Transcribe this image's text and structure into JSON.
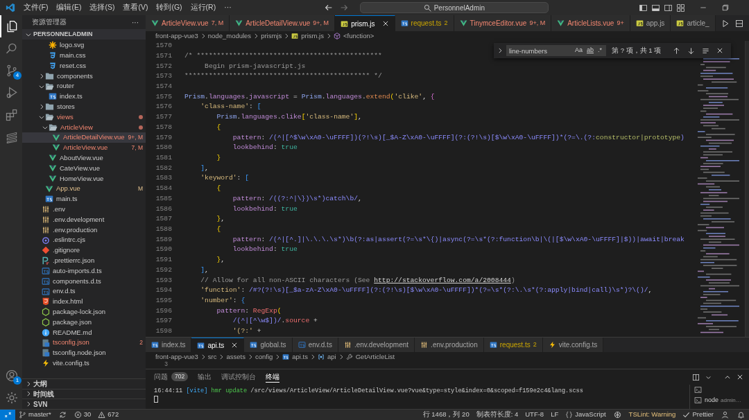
{
  "title_bar": {
    "menus": [
      "文件(F)",
      "编辑(E)",
      "选择(S)",
      "查看(V)",
      "转到(G)",
      "运行(R)",
      "···"
    ],
    "command_center": "PersonnelAdmin"
  },
  "activity_bar": {
    "items": [
      {
        "kind": "explorer",
        "selected": true
      },
      {
        "kind": "search",
        "selected": false
      },
      {
        "kind": "source-control",
        "selected": false,
        "badge": "4"
      },
      {
        "kind": "run-debug",
        "selected": false
      },
      {
        "kind": "extensions",
        "selected": false
      },
      {
        "kind": "s-plugin",
        "selected": false
      }
    ],
    "bottom": [
      {
        "kind": "account",
        "badge": "1"
      },
      {
        "kind": "settings"
      }
    ]
  },
  "sidebar": {
    "title": "资源管理器",
    "more": "···",
    "section": "PERSONNELADMIN",
    "tree": [
      {
        "children": [
          {
            "children": [
              {
                "label": "logo.svg",
                "kind": "svg",
                "selected": false
              },
              {
                "label": "main.css",
                "kind": "css",
                "selected": false
              },
              {
                "label": "reset.css",
                "kind": "css",
                "selected": false
              }
            ]
          },
          {
            "label": "components",
            "kind": "folder",
            "expanded": false,
            "selected": false
          },
          {
            "label": "router",
            "kind": "folder",
            "expanded": true,
            "selected": false,
            "children": [
              {
                "label": "index.ts",
                "kind": "ts",
                "selected": false
              }
            ]
          },
          {
            "label": "stores",
            "kind": "folder",
            "expanded": false,
            "selected": false
          },
          {
            "label": "views",
            "kind": "folder",
            "expanded": true,
            "selected": false,
            "error": true,
            "dot": true,
            "children": [
              {
                "label": "ArticleView",
                "kind": "folder",
                "expanded": true,
                "selected": false,
                "error": true,
                "dot": true,
                "children": [
                  {
                    "label": "ArticleDetailView.vue",
                    "kind": "vue",
                    "selected": true,
                    "error": true,
                    "badge": "9+, M"
                  },
                  {
                    "label": "ArticleView.vue",
                    "kind": "vue",
                    "selected": false,
                    "error": true,
                    "badge": "7, M"
                  }
                ]
              },
              {
                "label": "AboutView.vue",
                "kind": "vue",
                "selected": false
              },
              {
                "label": "CateView.vue",
                "kind": "vue",
                "selected": false
              },
              {
                "label": "HomeView.vue",
                "kind": "vue",
                "selected": false
              }
            ]
          },
          {
            "label": "App.vue",
            "kind": "vue",
            "selected": false,
            "modified": true,
            "badge": "M"
          },
          {
            "label": "main.ts",
            "kind": "ts",
            "selected": false
          }
        ]
      },
      {
        "label": ".env",
        "kind": "env",
        "selected": false
      },
      {
        "label": ".env.development",
        "kind": "env",
        "selected": false
      },
      {
        "label": ".env.production",
        "kind": "env",
        "selected": false
      },
      {
        "label": ".eslintrc.cjs",
        "kind": "eslint",
        "selected": false
      },
      {
        "label": ".gitignore",
        "kind": "git",
        "selected": false
      },
      {
        "label": ".prettierrc.json",
        "kind": "prettier",
        "selected": false
      },
      {
        "label": "auto-imports.d.ts",
        "kind": "tsd",
        "selected": false
      },
      {
        "label": "components.d.ts",
        "kind": "tsd",
        "selected": false
      },
      {
        "label": "env.d.ts",
        "kind": "tsd",
        "selected": false
      },
      {
        "label": "index.html",
        "kind": "html",
        "selected": false
      },
      {
        "label": "package-lock.json",
        "kind": "npm",
        "selected": false
      },
      {
        "label": "package.json",
        "kind": "npm",
        "selected": false
      },
      {
        "label": "README.md",
        "kind": "info",
        "selected": false
      },
      {
        "label": "tsconfig.json",
        "kind": "tsconfig",
        "selected": false,
        "error": true,
        "badge": "2"
      },
      {
        "label": "tsconfig.node.json",
        "kind": "tsconfig",
        "selected": false
      },
      {
        "label": "vite.config.ts",
        "kind": "vite",
        "selected": false
      }
    ],
    "panels": [
      "大纲",
      "时间线",
      "SVN"
    ]
  },
  "editor": {
    "tabs": [
      {
        "label": "ArticleView.vue",
        "kind": "vue",
        "badge": "7, M",
        "error": true,
        "selected": false
      },
      {
        "label": "ArticleDetailView.vue",
        "kind": "vue",
        "badge": "9+, M",
        "error": true,
        "selected": false
      },
      {
        "label": "prism.js",
        "kind": "js",
        "selected": true
      },
      {
        "label": "request.ts",
        "kind": "ts",
        "badge": "2",
        "warning": true,
        "selected": false
      },
      {
        "label": "TinymceEditor.vue",
        "kind": "vue",
        "badge": "9+, M",
        "error": true,
        "selected": false
      },
      {
        "label": "ArticleLists.vue",
        "kind": "vue",
        "badge": "9+",
        "error": true,
        "selected": false
      },
      {
        "label": "app.js",
        "kind": "js",
        "selected": false
      },
      {
        "label": "article_",
        "kind": "js",
        "selected": false
      }
    ],
    "breadcrumbs": [
      {
        "label": "front-app-vue3"
      },
      {
        "label": "node_modules"
      },
      {
        "label": "prismjs"
      },
      {
        "label": "prism.js",
        "kind": "js"
      },
      {
        "label": "<function>",
        "kind": "function"
      }
    ],
    "find": {
      "value": "line-numbers",
      "options": [
        {
          "label": "Aa",
          "on": false
        },
        {
          "label": "ab",
          "on": false
        },
        {
          "label": ".*",
          "on": false
        }
      ],
      "result": "第 ? 项，共 1 项"
    },
    "lines": [
      {
        "number": "1570"
      },
      {
        "number": "1571",
        "tokens": [
          {
            "kind": "comment",
            "text": "/* **********************************************"
          }
        ]
      },
      {
        "number": "1572",
        "tokens": [
          {
            "kind": "comment",
            "text": "     Begin prism-javascript.js"
          }
        ]
      },
      {
        "number": "1573",
        "tokens": [
          {
            "kind": "comment",
            "text": "********************************************** */"
          }
        ]
      },
      {
        "number": "1574"
      },
      {
        "number": "1575",
        "tokens": [
          {
            "kind": "ident",
            "text": "Prism"
          },
          {
            "kind": "plain",
            "text": "."
          },
          {
            "kind": "prop",
            "text": "languages"
          },
          {
            "kind": "plain",
            "text": "."
          },
          {
            "kind": "prop",
            "text": "javascript"
          },
          {
            "kind": "plain",
            "text": " = "
          },
          {
            "kind": "ident",
            "text": "Prism"
          },
          {
            "kind": "plain",
            "text": "."
          },
          {
            "kind": "prop",
            "text": "languages"
          },
          {
            "kind": "plain",
            "text": "."
          },
          {
            "kind": "func",
            "text": "extend"
          },
          {
            "kind": "b1",
            "text": "("
          },
          {
            "kind": "str",
            "text": "'clike'"
          },
          {
            "kind": "plain",
            "text": ", "
          },
          {
            "kind": "b2",
            "text": "{"
          }
        ]
      },
      {
        "number": "1576",
        "tokens": [
          {
            "kind": "str",
            "text": "    'class-name'"
          },
          {
            "kind": "plain",
            "text": ": "
          },
          {
            "kind": "b3",
            "text": "["
          }
        ]
      },
      {
        "number": "1577",
        "tokens": [
          {
            "kind": "ident",
            "text": "        Prism"
          },
          {
            "kind": "plain",
            "text": "."
          },
          {
            "kind": "prop",
            "text": "languages"
          },
          {
            "kind": "plain",
            "text": "."
          },
          {
            "kind": "prop",
            "text": "clike"
          },
          {
            "kind": "b1",
            "text": "["
          },
          {
            "kind": "str",
            "text": "'class-name'"
          },
          {
            "kind": "b1",
            "text": "]"
          },
          {
            "kind": "plain",
            "text": ","
          }
        ]
      },
      {
        "number": "1578",
        "tokens": [
          {
            "kind": "b1",
            "text": "        {"
          }
        ]
      },
      {
        "number": "1579",
        "tokens": [
          {
            "kind": "prop",
            "text": "            pattern"
          },
          {
            "kind": "plain",
            "text": ": "
          },
          {
            "kind": "re",
            "text": "/(^|[^$\\w\\xA0-\\uFFFF])(?!\\s)[_$A-Z\\xA0-\\uFFFF](?:(?!\\s)[$\\w\\xA0-\\uFFFF])*(?=\\.(?:"
          },
          {
            "kind": "re2",
            "text": "constructor|prototype"
          },
          {
            "kind": "re",
            "text": ")"
          }
        ]
      },
      {
        "number": "1580",
        "tokens": [
          {
            "kind": "prop",
            "text": "            lookbehind"
          },
          {
            "kind": "plain",
            "text": ": "
          },
          {
            "kind": "bool",
            "text": "true"
          }
        ]
      },
      {
        "number": "1581",
        "tokens": [
          {
            "kind": "b1",
            "text": "        }"
          }
        ]
      },
      {
        "number": "1582",
        "tokens": [
          {
            "kind": "b3",
            "text": "    ]"
          },
          {
            "kind": "plain",
            "text": ","
          }
        ]
      },
      {
        "number": "1583",
        "tokens": [
          {
            "kind": "str",
            "text": "    'keyword'"
          },
          {
            "kind": "plain",
            "text": ": "
          },
          {
            "kind": "b3",
            "text": "["
          }
        ]
      },
      {
        "number": "1584",
        "tokens": [
          {
            "kind": "b1",
            "text": "        {"
          }
        ]
      },
      {
        "number": "1585",
        "tokens": [
          {
            "kind": "prop",
            "text": "            pattern"
          },
          {
            "kind": "plain",
            "text": ": "
          },
          {
            "kind": "re",
            "text": "/((?:^|\\})\\s*)catch\\b/"
          },
          {
            "kind": "plain",
            "text": ","
          }
        ]
      },
      {
        "number": "1586",
        "tokens": [
          {
            "kind": "prop",
            "text": "            lookbehind"
          },
          {
            "kind": "plain",
            "text": ": "
          },
          {
            "kind": "bool",
            "text": "true"
          }
        ]
      },
      {
        "number": "1587",
        "tokens": [
          {
            "kind": "b1",
            "text": "        }"
          },
          {
            "kind": "plain",
            "text": ","
          }
        ]
      },
      {
        "number": "1588",
        "tokens": [
          {
            "kind": "b1",
            "text": "        {"
          }
        ]
      },
      {
        "number": "1589",
        "tokens": [
          {
            "kind": "prop",
            "text": "            pattern"
          },
          {
            "kind": "plain",
            "text": ": "
          },
          {
            "kind": "re",
            "text": "/(^|[^.]|\\.\\.\\.\\s*)\\b(?:as|assert(?=\\s*\\{)|async(?=\\s*(?:function\\b|\\(|[$\\w\\xA0-\\uFFFF]|$))|await|break"
          }
        ]
      },
      {
        "number": "1590",
        "tokens": [
          {
            "kind": "prop",
            "text": "            lookbehind"
          },
          {
            "kind": "plain",
            "text": ": "
          },
          {
            "kind": "bool",
            "text": "true"
          }
        ]
      },
      {
        "number": "1591",
        "tokens": [
          {
            "kind": "b1",
            "text": "        }"
          },
          {
            "kind": "plain",
            "text": ","
          }
        ]
      },
      {
        "number": "1592",
        "tokens": [
          {
            "kind": "b3",
            "text": "    ]"
          },
          {
            "kind": "plain",
            "text": ","
          }
        ]
      },
      {
        "number": "1593",
        "tokens": [
          {
            "kind": "comment",
            "text": "    // Allow for all non-ASCII characters (See "
          },
          {
            "kind": "link",
            "text": "http://stackoverflow.com/a/2008444"
          },
          {
            "kind": "comment",
            "text": ")"
          }
        ]
      },
      {
        "number": "1594",
        "tokens": [
          {
            "kind": "str",
            "text": "    'function'"
          },
          {
            "kind": "plain",
            "text": ": "
          },
          {
            "kind": "re",
            "text": "/#?(?!\\s)[_$a-zA-Z\\xA0-\\uFFFF](?:(?!\\s)[$\\w\\xA0-\\uFFFF])*(?=\\s*(?:\\.\\s*(?:apply|bind|call)\\s*)?\\()/"
          },
          {
            "kind": "plain",
            "text": ","
          }
        ]
      },
      {
        "number": "1595",
        "tokens": [
          {
            "kind": "str",
            "text": "    'number'"
          },
          {
            "kind": "plain",
            "text": ": "
          },
          {
            "kind": "b3",
            "text": "{"
          }
        ]
      },
      {
        "number": "1596",
        "tokens": [
          {
            "kind": "prop",
            "text": "        pattern"
          },
          {
            "kind": "plain",
            "text": ": "
          },
          {
            "kind": "cls",
            "text": "RegExp"
          },
          {
            "kind": "b1",
            "text": "("
          }
        ]
      },
      {
        "number": "1597",
        "tokens": [
          {
            "kind": "re",
            "text": "            /(^|[^\\w$])/"
          },
          {
            "kind": "plain",
            "text": "."
          },
          {
            "kind": "cls",
            "text": "source"
          },
          {
            "kind": "plain",
            "text": " +"
          }
        ]
      },
      {
        "number": "1598",
        "tokens": [
          {
            "kind": "str",
            "text": "            '(?:'"
          },
          {
            "kind": "plain",
            "text": " +"
          }
        ]
      }
    ]
  },
  "lower_editor": {
    "tabs": [
      {
        "label": "index.ts",
        "kind": "ts",
        "selected": false
      },
      {
        "label": "api.ts",
        "kind": "ts",
        "selected": true
      },
      {
        "label": "global.ts",
        "kind": "ts",
        "selected": false
      },
      {
        "label": "env.d.ts",
        "kind": "tsd",
        "selected": false
      },
      {
        "label": ".env.development",
        "kind": "env",
        "selected": false
      },
      {
        "label": ".env.production",
        "kind": "env",
        "selected": false
      },
      {
        "label": "request.ts",
        "kind": "ts",
        "badge": "2",
        "warning": true,
        "selected": false
      },
      {
        "label": "vite.config.ts",
        "kind": "vite",
        "selected": false
      }
    ],
    "breadcrumbs": [
      {
        "label": "front-app-vue3"
      },
      {
        "label": "src"
      },
      {
        "label": "assets"
      },
      {
        "label": "config"
      },
      {
        "label": "api.ts",
        "kind": "ts"
      },
      {
        "label": "api",
        "kind": "variable"
      },
      {
        "label": "GetArticleList",
        "kind": "method"
      }
    ],
    "line_numbers": [
      "3"
    ]
  },
  "panel": {
    "tabs": [
      {
        "label": "问题",
        "badge": "702",
        "selected": false
      },
      {
        "label": "输出",
        "selected": false
      },
      {
        "label": "调试控制台",
        "selected": false
      },
      {
        "label": "终端",
        "selected": true
      }
    ],
    "terminal_lines": [
      [
        {
          "kind": "time",
          "text": "16:44:11 "
        },
        {
          "kind": "tag",
          "text": "[vite]"
        },
        {
          "kind": "accent",
          "text": " hmr update"
        },
        {
          "kind": "time",
          "text": " /src/views/ArticleView/ArticleDetailView.vue?vue&type=style&index=0&scoped=f159e2c4&lang.scss"
        }
      ]
    ],
    "terminals": [
      {
        "kind": "shell",
        "selected": false
      },
      {
        "kind": "node",
        "label": "node",
        "detail": "admin…",
        "selected": false
      }
    ]
  },
  "status_bar": {
    "left": [
      {
        "kind": "remote"
      },
      {
        "kind": "branch",
        "text": "master*"
      },
      {
        "kind": "sync"
      },
      {
        "kind": "errors",
        "text": "30"
      },
      {
        "kind": "warnings",
        "text": "672"
      }
    ],
    "right": [
      {
        "kind": "text",
        "text": "行 1468，列 20"
      },
      {
        "kind": "text",
        "text": "制表符长度: 4"
      },
      {
        "kind": "text",
        "text": "UTF-8"
      },
      {
        "kind": "text",
        "text": "LF"
      },
      {
        "kind": "language",
        "text": "JavaScript"
      },
      {
        "kind": "tool"
      },
      {
        "kind": "warning",
        "text": "TSLint: Warning"
      },
      {
        "kind": "check",
        "text": "Prettier"
      },
      {
        "kind": "feedback"
      },
      {
        "kind": "bell"
      }
    ]
  }
}
